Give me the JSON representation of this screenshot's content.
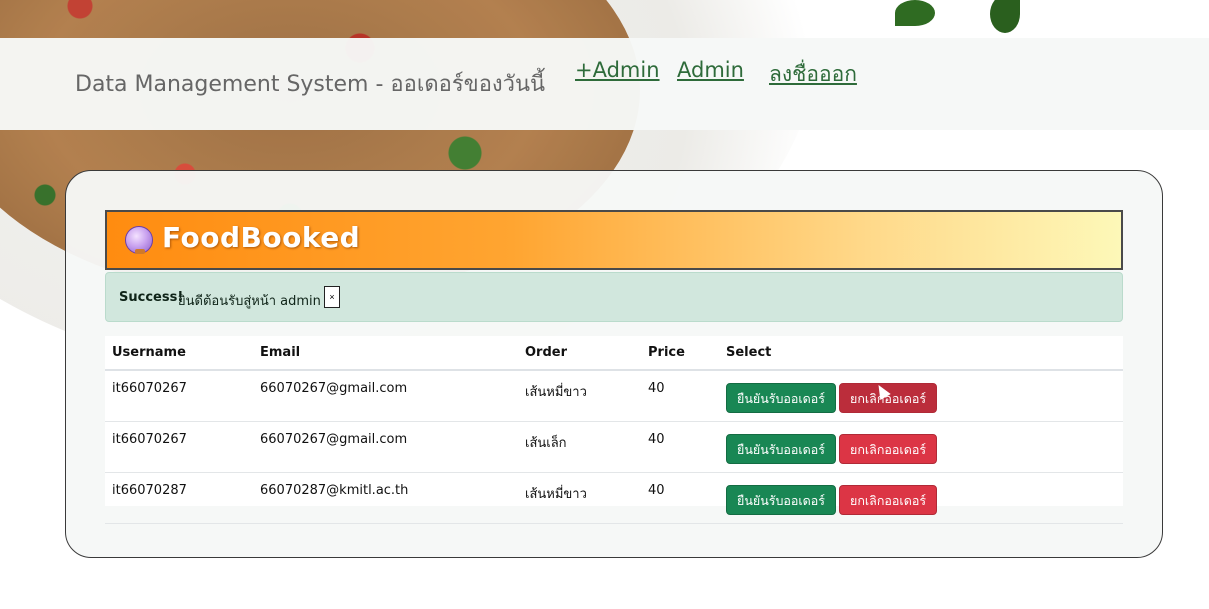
{
  "navbar": {
    "brand": "Data Management System - ออเดอร์ของวันนี้",
    "links": [
      "+Admin",
      "Admin",
      "ลงชื่อออก"
    ]
  },
  "banner": {
    "title": "FoodBooked"
  },
  "alert": {
    "strong": "Success!",
    "message": "ยินดีต้อนรับสู่หน้า admin",
    "close": "×"
  },
  "table": {
    "headers": [
      "Username",
      "Email",
      "Order",
      "Price",
      "Select"
    ],
    "rows": [
      {
        "username": "it66070267",
        "email": "66070267@gmail.com",
        "order": "เส้นหมี่ขาว",
        "price": "40"
      },
      {
        "username": "it66070267",
        "email": "66070267@gmail.com",
        "order": "เส้นเล็ก",
        "price": "40"
      },
      {
        "username": "it66070287",
        "email": "66070287@kmitl.ac.th",
        "order": "เส้นหมี่ขาว",
        "price": "40"
      }
    ],
    "confirm_label": "ยืนยันรับออเดอร์",
    "cancel_label": "ยกเลิกออเดอร์"
  },
  "colors": {
    "success": "#198754",
    "danger": "#dc3545",
    "link": "#2e6b3a",
    "alert_bg": "#d1e7dd"
  }
}
